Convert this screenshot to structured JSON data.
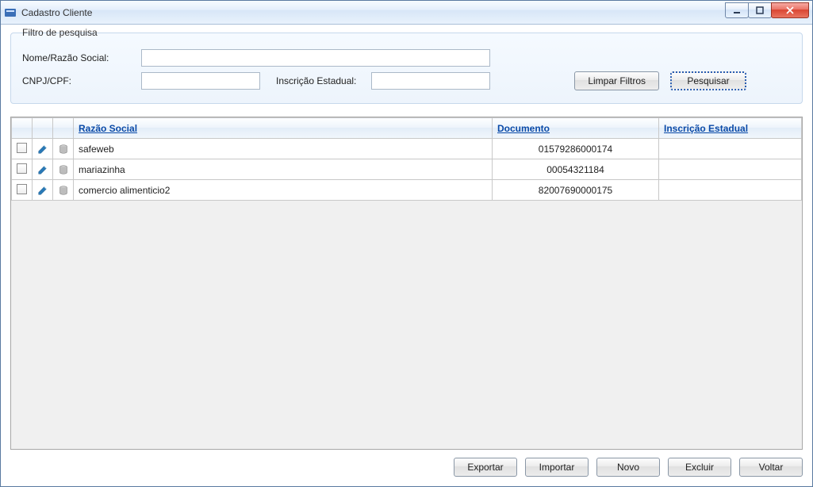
{
  "window": {
    "title": "Cadastro Cliente"
  },
  "filter": {
    "legend": "Filtro de pesquisa",
    "name_label": "Nome/Razão Social:",
    "doc_label": "CNPJ/CPF:",
    "ie_label": "Inscrição Estadual:",
    "name_value": "",
    "doc_value": "",
    "ie_value": "",
    "clear_label": "Limpar Filtros",
    "search_label": "Pesquisar"
  },
  "grid": {
    "headers": {
      "razao": "Razão Social",
      "documento": "Documento",
      "inscricao": "Inscrição Estadual"
    },
    "rows": [
      {
        "razao": "safeweb",
        "documento": "01579286000174",
        "inscricao": ""
      },
      {
        "razao": "mariazinha",
        "documento": "00054321184",
        "inscricao": ""
      },
      {
        "razao": "comercio alimenticio2",
        "documento": "82007690000175",
        "inscricao": ""
      }
    ]
  },
  "footer": {
    "exportar": "Exportar",
    "importar": "Importar",
    "novo": "Novo",
    "excluir": "Excluir",
    "voltar": "Voltar"
  }
}
